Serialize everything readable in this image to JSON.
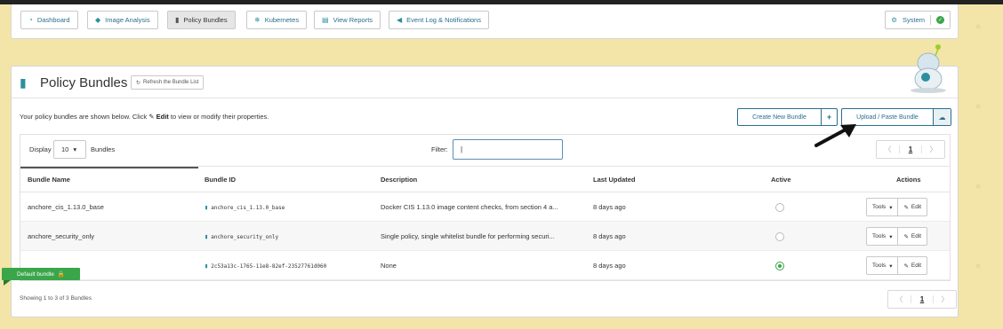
{
  "nav": {
    "items": [
      {
        "label": "Dashboard",
        "icon": "dashboard-icon"
      },
      {
        "label": "Image Analysis",
        "icon": "tag-icon"
      },
      {
        "label": "Policy Bundles",
        "icon": "briefcase-icon",
        "active": true
      },
      {
        "label": "Kubernetes",
        "icon": "kubernetes-icon"
      },
      {
        "label": "View Reports",
        "icon": "report-icon"
      },
      {
        "label": "Event Log & Notifications",
        "icon": "bullhorn-icon"
      }
    ],
    "system_label": "System",
    "system_status": "ok"
  },
  "panel": {
    "title": "Policy Bundles",
    "refresh_label": "Refresh the Bundle List",
    "intro_before": "Your policy bundles are shown below. Click",
    "intro_edit": "Edit",
    "intro_after": "to view or modify their properties.",
    "create_label": "Create New Bundle",
    "upload_label": "Upload / Paste Bundle"
  },
  "table": {
    "display_label": "Display",
    "page_size": "10",
    "bundles_label": "Bundles",
    "filter_label": "Filter:",
    "filter_value": "",
    "pager": {
      "prev": "〈",
      "current": "1",
      "next": "〉"
    },
    "columns": [
      "Bundle Name",
      "Bundle ID",
      "Description",
      "Last Updated",
      "Active",
      "Actions"
    ],
    "rows": [
      {
        "name": "anchore_cis_1.13.0_base",
        "id": "anchore_cis_1.13.0_base",
        "description": "Docker CIS 1.13.0 image content checks, from section 4 a...",
        "updated": "8 days ago",
        "active": false
      },
      {
        "name": "anchore_security_only",
        "id": "anchore_security_only",
        "description": "Single policy, single whitelist bundle for performing securi...",
        "updated": "8 days ago",
        "active": false
      },
      {
        "name": "",
        "id": "2c53a13c-1765-11e8-82ef-23527761d060",
        "description": "None",
        "updated": "8 days ago",
        "active": true
      }
    ],
    "tools_label": "Tools",
    "edit_label": "Edit",
    "default_badge": "Default bundle",
    "footer": "Showing 1 to 3 of 3 Bundles"
  },
  "colors": {
    "accent": "#2a6e8f",
    "teal": "#2c8f9f",
    "success": "#3aa64a",
    "background": "#f3e5a8"
  }
}
